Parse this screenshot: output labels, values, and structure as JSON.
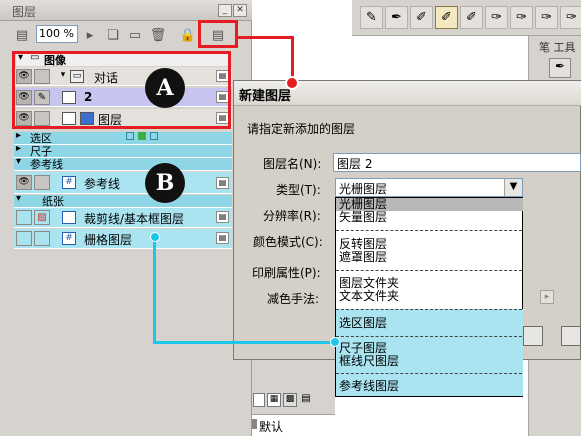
{
  "layer_panel": {
    "title": "图层",
    "opacity": "100 %",
    "rows": [
      {
        "label": "图像"
      },
      {
        "label": "对话"
      },
      {
        "label": "2"
      },
      {
        "label": "图层"
      },
      {
        "label": "选区"
      },
      {
        "label": "尺子"
      },
      {
        "label": "参考线"
      },
      {
        "label": "参考线"
      },
      {
        "label": "纸张"
      },
      {
        "label": "裁剪线/基本框图层"
      },
      {
        "label": "栅格图层"
      }
    ]
  },
  "annotations": {
    "a": "A",
    "b": "B"
  },
  "right_panel": {
    "tab_label": "笔 工具"
  },
  "dialog": {
    "title": "新建图层",
    "prompt": "请指定新添加的图层",
    "name_label": "图层名(N):",
    "name_value": "图层 2",
    "type_label": "类型(T):",
    "type_value": "光栅图层",
    "resolution_label": "分辨率(R):",
    "color_mode_label": "颜色模式(C):",
    "print_label": "印刷属性(P):",
    "reduce_label": "减色手法:",
    "type_options": [
      "光栅图层",
      "矢量图层",
      "反转图层",
      "遮罩图层",
      "图层文件夹",
      "文本文件夹",
      "选区图层",
      "尺子图层",
      "框线尺图层",
      "参考线图层"
    ]
  },
  "bottom": {
    "default_label": "默认"
  },
  "colors": {
    "annotation_red": "#e51c24",
    "annotation_cyan": "#1ec6ea",
    "layer_cyan": "#a9e4f0",
    "selected_blue": "#c7c5f0"
  }
}
